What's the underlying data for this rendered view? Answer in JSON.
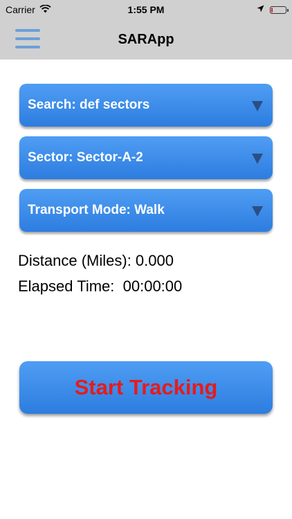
{
  "status_bar": {
    "carrier": "Carrier",
    "time": "1:55 PM",
    "wifi_icon": "wifi-icon",
    "location_icon": "location-arrow-icon",
    "battery_icon": "battery-low-icon",
    "battery_level": 0.1,
    "battery_color": "#e0201f"
  },
  "nav": {
    "title": "SARApp",
    "menu_icon": "hamburger-menu-icon",
    "menu_color": "#6aa0d8"
  },
  "dropdowns": {
    "search_label": "Search: def sectors",
    "sector_label": "Sector: Sector-A-2",
    "transport_label": "Transport Mode: Walk"
  },
  "info": {
    "distance_label": "Distance (Miles): 0.000",
    "elapsed_label": "Elapsed Time:  00:00:00"
  },
  "actions": {
    "start_tracking_label": "Start Tracking",
    "button_color": "#3b8ae9",
    "button_text_color": "#e61b1b"
  }
}
